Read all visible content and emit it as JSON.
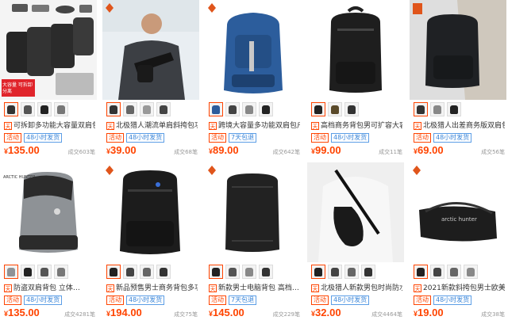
{
  "products": [
    {
      "title": "可拆卸多功能大容量双肩包…",
      "badge1": "活动",
      "badge2": "48小时发货",
      "price": "135.00",
      "sold": "成交603笔",
      "overlay": "大容量 可拆卸分离"
    },
    {
      "title": "北极猎人潮流单肩斜挎包功…",
      "badge1": "活动",
      "badge2": "48小时发货",
      "price": "39.00",
      "sold": "成交68笔"
    },
    {
      "title": "跨境大容量多功能双肩包户…",
      "badge1": "活动",
      "badge2": "7天包退",
      "price": "89.00",
      "sold": "成交642笔"
    },
    {
      "title": "高档商务背包男可扩容大容…",
      "badge1": "活动",
      "badge2": "48小时发货",
      "price": "99.00",
      "sold": "成交11笔"
    },
    {
      "title": "北极猎人出差商务版双肩包男士…",
      "badge1": "活动",
      "badge2": "48小时发货",
      "price": "69.00",
      "sold": "成交56笔"
    },
    {
      "title": "防盗双肩背包 立体…",
      "badge1": "活动",
      "badge2": "48小时发货",
      "price": "135.00",
      "sold": "成交4281笔"
    },
    {
      "title": "新品预售男士商务背包多功…",
      "badge1": "活动",
      "badge2": "48小时发货",
      "price": "194.00",
      "sold": "成交75笔"
    },
    {
      "title": "新款男士电脑背包 高档…",
      "badge1": "活动",
      "badge2": "7天包退",
      "price": "145.00",
      "sold": "成交229笔"
    },
    {
      "title": "北极猎人新款男包时尚防水…",
      "badge1": "活动",
      "badge2": "48小时发货",
      "price": "32.00",
      "sold": "成交4464笔"
    },
    {
      "title": "2021新款斜挎包男士欧美潮…",
      "badge1": "活动",
      "badge2": "48小时发货",
      "price": "19.00",
      "sold": "成交38笔"
    }
  ],
  "currency": "¥",
  "shop_tag": "天",
  "logo_text": "ARCTIC HUNTER",
  "brand_text": "arctic hunter"
}
